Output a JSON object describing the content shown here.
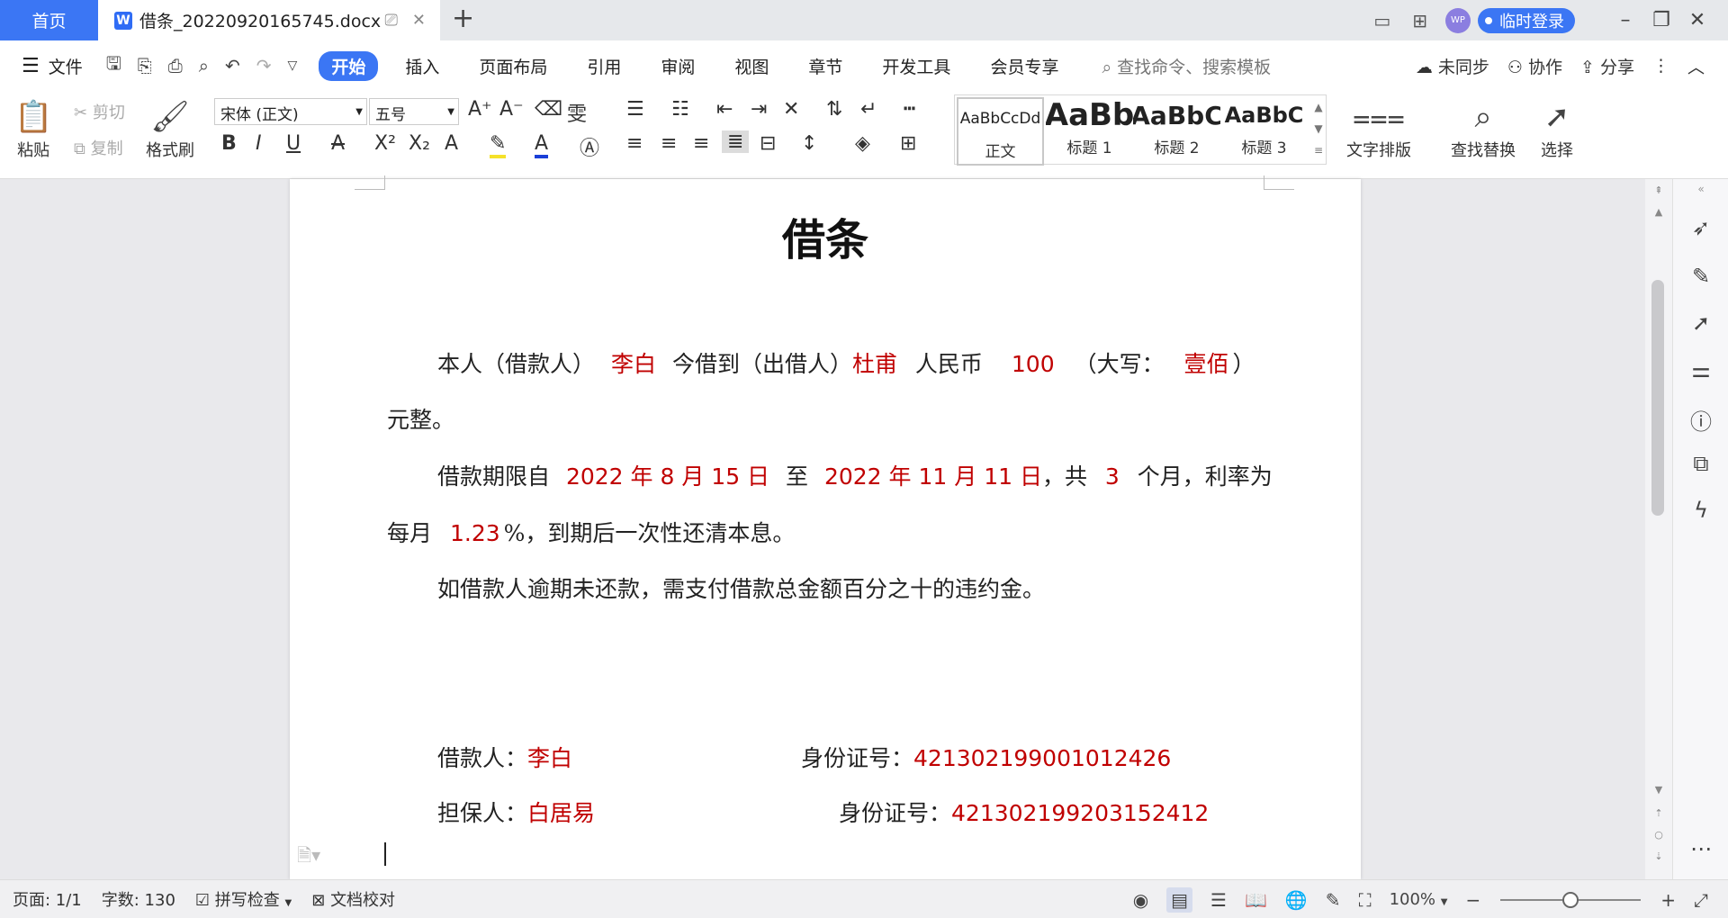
{
  "titlebar": {
    "home_tab": "首页",
    "doc_tab": "借条_20220920165745.docx",
    "app_logo": "W",
    "new_tab": "+",
    "avatar_text": "WP",
    "login_button": "临时登录"
  },
  "menubar": {
    "file": "文件",
    "tabs": [
      "开始",
      "插入",
      "页面布局",
      "引用",
      "审阅",
      "视图",
      "章节",
      "开发工具",
      "会员专享"
    ],
    "active_tab": "开始",
    "search_placeholder": "查找命令、搜索模板",
    "sync": "未同步",
    "collab": "协作",
    "share": "分享"
  },
  "ribbon": {
    "paste": "粘贴",
    "cut": "剪切",
    "copy": "复制",
    "format_painter": "格式刷",
    "font_name": "宋体 (正文)",
    "font_size": "五号",
    "styles": [
      {
        "sample": "AaBbCcDd",
        "label": "正文"
      },
      {
        "sample": "AaBb",
        "label": "标题 1"
      },
      {
        "sample": "AaBbC",
        "label": "标题 2"
      },
      {
        "sample": "AaBbC",
        "label": "标题 3"
      }
    ],
    "text_layout": "文字排版",
    "find_replace": "查找替换",
    "select": "选择"
  },
  "document": {
    "title": "借条",
    "p1": {
      "a": "本人（借款人）",
      "borrower": "李白",
      "b": "今借到（出借人）",
      "lender": "杜甫",
      "c": "人民币",
      "amount": "100",
      "d": "（大写：",
      "amount_upper": "壹佰",
      "e": "）",
      "f": "元整。"
    },
    "p2": {
      "a": "借款期限自",
      "start_date": "2022 年 8 月 15 日",
      "b": "至",
      "end_date": "2022 年 11 月 11 日",
      "c": "，共",
      "months": "3",
      "d": "个月，利率为",
      "e": "每月",
      "rate": "1.23",
      "f": "%，到期后一次性还清本息。"
    },
    "p3": "如借款人逾期未还款，需支付借款总金额百分之十的违约金。",
    "sign1": {
      "label": "借款人：",
      "name": "李白",
      "id_label": "身份证号：",
      "id": "421302199001012426"
    },
    "sign2": {
      "label": "担保人：",
      "name": "白居易",
      "id_label": "身份证号：",
      "id": "421302199203152412"
    }
  },
  "statusbar": {
    "page": "页面: 1/1",
    "words": "字数: 130",
    "spell": "拼写检查",
    "proof": "文档校对",
    "zoom": "100%",
    "zoom_level": 0.5
  },
  "colors": {
    "accent": "#3b76f4",
    "red_text": "#c00000"
  }
}
